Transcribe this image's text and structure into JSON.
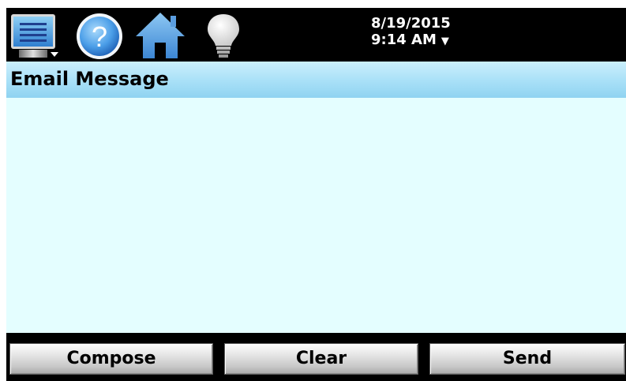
{
  "toolbar": {
    "icons": [
      "monitor-menu-icon",
      "help-icon",
      "home-icon",
      "lightbulb-icon"
    ],
    "date": "8/19/2015",
    "time": "9:14 AM",
    "dropdown_glyph": "▼"
  },
  "header": {
    "title": "Email Message"
  },
  "message": {
    "body": ""
  },
  "buttons": {
    "compose": "Compose",
    "clear": "Clear",
    "send": "Send"
  },
  "colors": {
    "title_bar": "#a8e0f7",
    "message_bg": "#e4feff",
    "icon_blue": "#4a90d9"
  }
}
